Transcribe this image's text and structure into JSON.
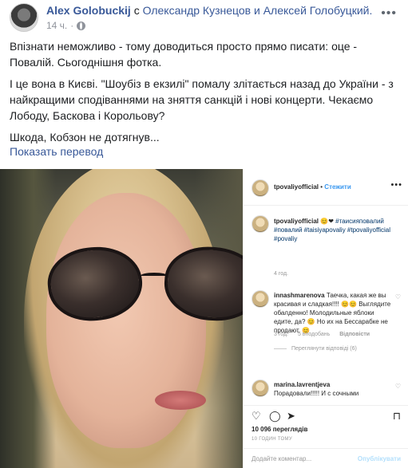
{
  "post": {
    "author": "Alex Golobuckij",
    "with_word": "с",
    "tagged": "Олександр Кузнецов и Алексей Голобуцкий.",
    "time": "14 ч.",
    "more_icon": "ellipsis-icon",
    "paragraphs": [
      "Впізнати неможливо - тому доводиться просто прямо писати: оце - Повалій. Сьогоднішня фотка.",
      "І це вона в Києві. \"Шоубіз в екзилі\" помалу злітається назад до України - з найкращими сподіваннями на зняття санкцій і нові концерти. Чекаємо Лободу, Баскова і Корольову?",
      "Шкода, Кобзон не дотягнув..."
    ],
    "translate_link": "Показать перевод"
  },
  "instagram": {
    "header": {
      "username": "tpovaliyofficial",
      "separator": "•",
      "follow_label": "Стежити"
    },
    "caption": {
      "username": "tpovaliyofficial",
      "emoji": "😊❤",
      "tags": "#таисияповалий #повалий #taisiyapovaliy #tpovaliyofficial #povaliy",
      "age": "4 год."
    },
    "comments": [
      {
        "username": "innashmarenova",
        "text": "Таечка, какая же вы красивая и сладкая!!!! 😊😊 Выглядите обалденно! Молодильные яблоки едите, да? 😊 Но их на Бессарабке не продают. 😊",
        "age": "3 год.",
        "likes": "5 вподобань",
        "reply_label": "Відповісти",
        "view_replies": "Переглянути відповіді (6)"
      },
      {
        "username": "marina.lavrentjeva",
        "text": "Порадовали!!!!! И с сочными",
        "age": "",
        "likes": "",
        "reply_label": "",
        "view_replies": ""
      }
    ],
    "views": "10 096 переглядів",
    "post_age": "10 ГОДИН ТОМУ",
    "comment_placeholder": "Додайте коментар...",
    "publish_label": "Опублікувати"
  }
}
